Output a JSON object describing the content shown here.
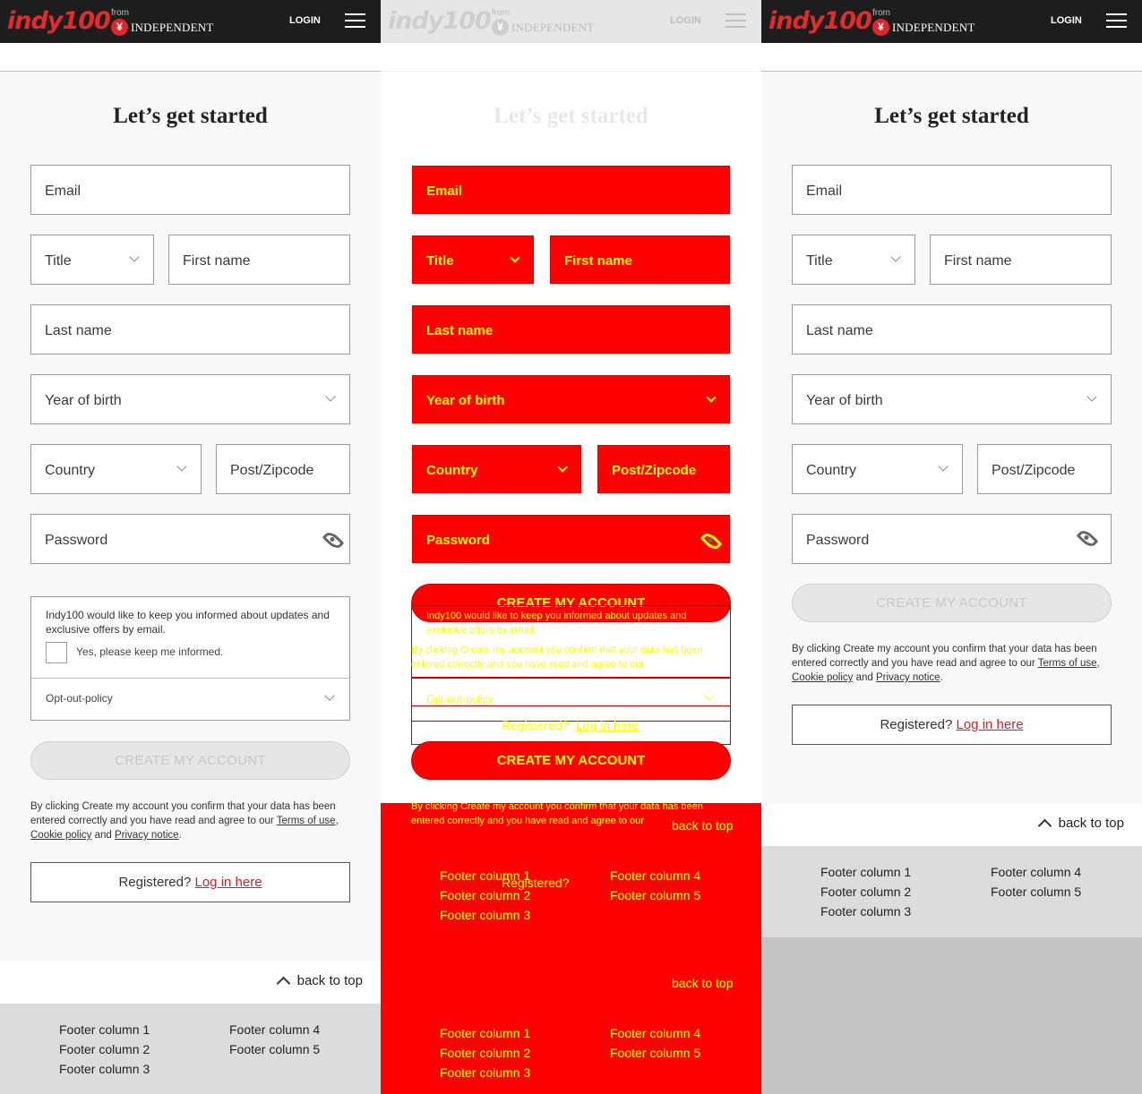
{
  "header": {
    "logo": "indy100",
    "from": "from",
    "publisher": "INDEPENDENT",
    "login": "LOGIN"
  },
  "form": {
    "title": "Let’s get started",
    "email": "Email",
    "title_select": "Title",
    "first_name": "First name",
    "last_name": "Last name",
    "year_of_birth": "Year of birth",
    "country": "Country",
    "postcode": "Post/Zipcode",
    "password": "Password",
    "optin_text": "Indy100 would like to keep you informed about updates and exclusive offers by email.",
    "optin_checkbox": "Yes, please keep me informed.",
    "opt_out_policy": "Opt-out-policy",
    "create_button": "CREATE MY ACCOUNT",
    "disclaimer_pre": "By clicking Create my account you confirm that your data has been entered correctly and you have read and agree to our",
    "terms": "Terms of use",
    "cookie": "Cookie policy",
    "and": "and",
    "privacy": "Privacy notice",
    "registered": "Registered?",
    "login_here": "Log in here"
  },
  "back_to_top": "back to top",
  "footer": {
    "col1": [
      "Footer column 1",
      "Footer column 2",
      "Footer column 3"
    ],
    "col2": [
      "Footer column 4",
      "Footer column 5"
    ]
  }
}
